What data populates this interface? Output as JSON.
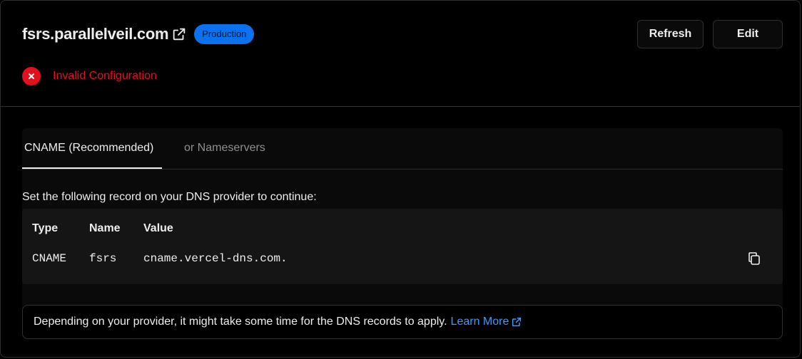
{
  "domain": {
    "name": "fsrs.parallelveil.com",
    "environment_badge": "Production",
    "status": "Invalid Configuration",
    "status_color": "#e5101f",
    "badge_color": "#0a72ef"
  },
  "actions": {
    "refresh_label": "Refresh",
    "edit_label": "Edit"
  },
  "tabs": [
    {
      "label": "CNAME (Recommended)",
      "active": true
    },
    {
      "label": "or Nameservers",
      "active": false
    }
  ],
  "instruction": "Set the following record on your DNS provider to continue:",
  "record_table": {
    "headers": [
      "Type",
      "Name",
      "Value"
    ],
    "rows": [
      {
        "type": "CNAME",
        "name": "fsrs",
        "value": "cname.vercel-dns.com."
      }
    ]
  },
  "note": {
    "text": "Depending on your provider, it might take some time for the DNS records to apply.",
    "link_label": "Learn More",
    "link_color": "#3b9bff"
  },
  "icons": {
    "domain_link": "external-link-icon",
    "status": "x-circle-icon",
    "copy": "copy-icon",
    "learn_more": "external-link-icon"
  }
}
